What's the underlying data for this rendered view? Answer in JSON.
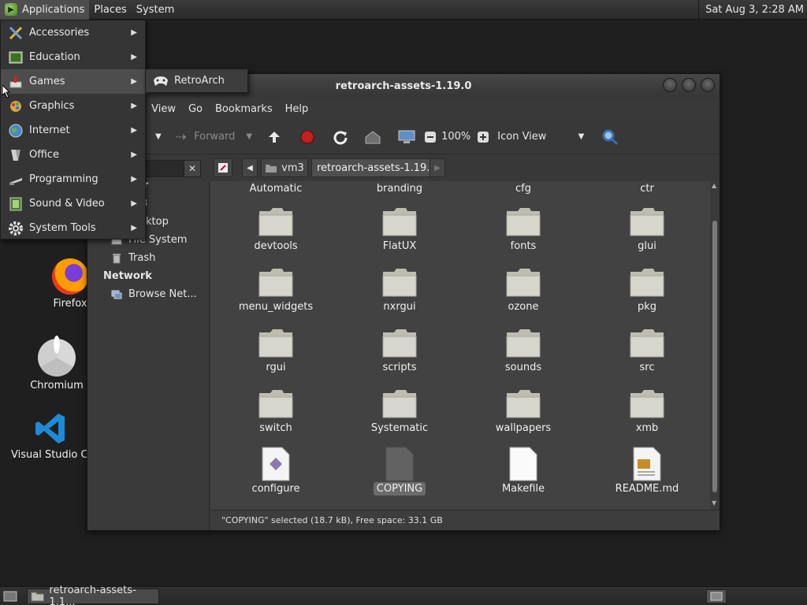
{
  "top_panel": {
    "menus": [
      "Applications",
      "Places",
      "System"
    ],
    "clock": "Sat Aug  3,  2:28 AM"
  },
  "desktop_icons": [
    {
      "label": "Firefox",
      "icon": "firefox-icon"
    },
    {
      "label": "Chromium",
      "icon": "chromium-icon"
    },
    {
      "label": "Visual Studio Co",
      "icon": "vscode-icon"
    }
  ],
  "app_menu": {
    "items": [
      "Accessories",
      "Education",
      "Games",
      "Graphics",
      "Internet",
      "Office",
      "Programming",
      "Sound & Video",
      "System Tools"
    ],
    "hovered": "Games",
    "submenu": {
      "item": "RetroArch"
    }
  },
  "window": {
    "title": "retroarch-assets-1.19.0",
    "menus": [
      "t",
      "View",
      "Go",
      "Bookmarks",
      "Help"
    ],
    "toolbar": {
      "forward": "Forward",
      "zoom": "100%",
      "view_mode": "Icon View"
    },
    "path": {
      "parent": "vm3",
      "current": "retroarch-assets-1.19.0"
    },
    "sidebar": {
      "items": [
        "er",
        "3",
        "ktop",
        "File System",
        "Trash"
      ],
      "network_header": "Network",
      "network_items": [
        "Browse Net..."
      ]
    },
    "top_row": [
      "Automatic",
      "branding",
      "cfg",
      "ctr"
    ],
    "folders": [
      "devtools",
      "FlatUX",
      "fonts",
      "glui",
      "menu_widgets",
      "nxrgui",
      "ozone",
      "pkg",
      "rgui",
      "scripts",
      "sounds",
      "src",
      "switch",
      "Systematic",
      "wallpapers",
      "xmb"
    ],
    "files": [
      {
        "name": "configure",
        "icon": "script-file-icon"
      },
      {
        "name": "COPYING",
        "icon": "generic-file-icon",
        "selected": true
      },
      {
        "name": "Makefile",
        "icon": "blank-file-icon"
      },
      {
        "name": "README.md",
        "icon": "text-image-file-icon"
      }
    ],
    "status": "\"COPYING\" selected (18.7 kB), Free space: 33.1 GB"
  },
  "taskbar": {
    "task": "retroarch-assets-1.1..."
  }
}
